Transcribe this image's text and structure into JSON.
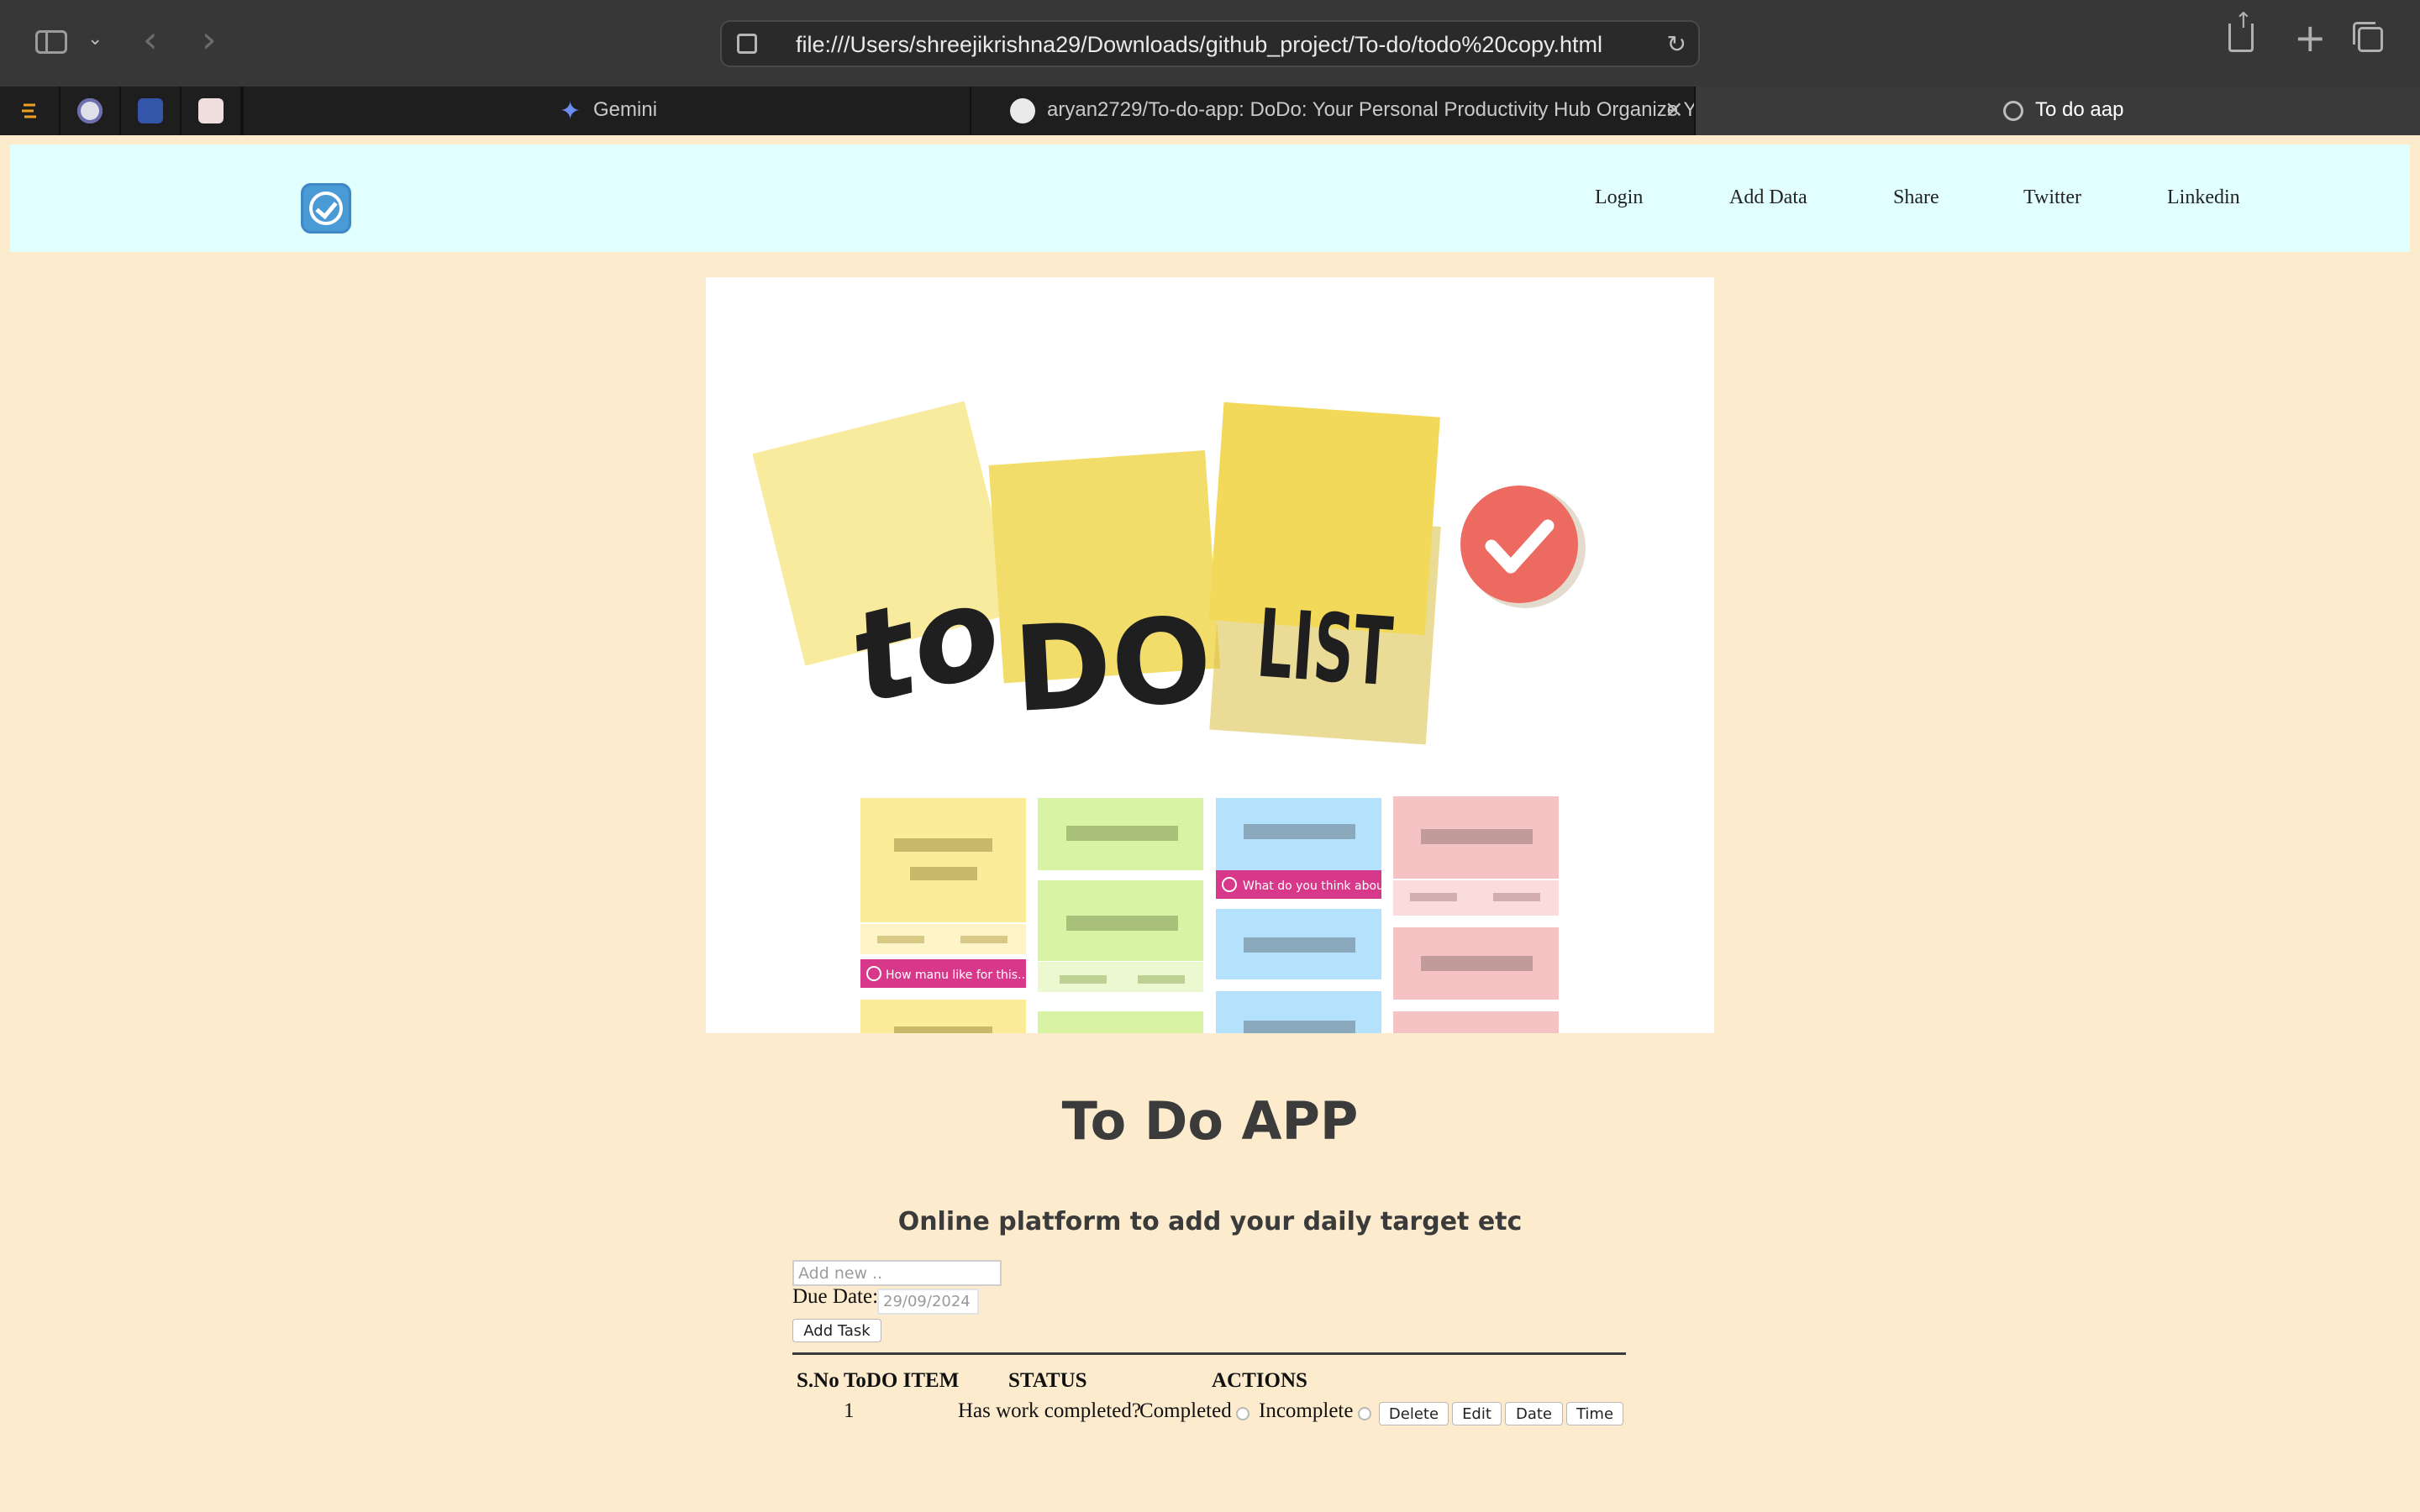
{
  "browser": {
    "url": "file:///Users/shreejikrishna29/Downloads/github_project/To-do/todo%20copy.html",
    "tabs": [
      {
        "label": "Gemini"
      },
      {
        "label": "aryan2729/To-do-app: DoDo: Your Personal Productivity Hub Organize Y..."
      },
      {
        "label": "To do aap"
      }
    ],
    "icons": [
      "sidebar-icon",
      "chevron-down-icon",
      "back-icon",
      "forward-icon",
      "page-settings-icon",
      "reload-icon",
      "share-icon",
      "new-tab-icon",
      "tab-overview-icon",
      "close-icon"
    ]
  },
  "navbar": {
    "links": [
      "Login",
      "Add Data",
      "Share",
      "Twitter",
      "Linkedin"
    ]
  },
  "hero": {
    "sticky_words": [
      "to",
      "DO",
      "LIST"
    ],
    "card_captions": [
      "How manu like for this...",
      "What do you think about..."
    ]
  },
  "main": {
    "title": "To Do APP",
    "subtitle": "Online platform to add your daily target etc"
  },
  "form": {
    "placeholder": "Add new ..",
    "due_label": "Due Date:",
    "date_value": "29/09/2024",
    "add_button": "Add Task"
  },
  "table": {
    "headers": [
      "S.No",
      "ToDO ITEM",
      "STATUS",
      "ACTIONS"
    ],
    "rows": [
      {
        "sno": "1",
        "question": "Has work completed?",
        "completed_label": "Completed",
        "incomplete_label": "Incomplete",
        "buttons": [
          "Delete",
          "Edit",
          "Date",
          "Time"
        ]
      }
    ]
  },
  "colors": {
    "page_bg": "#fcebcd",
    "navbar_bg": "#e1ffff",
    "logo": "#4a9ad6",
    "check_badge": "#ec6a60",
    "caption_tag": "#d8388a"
  }
}
